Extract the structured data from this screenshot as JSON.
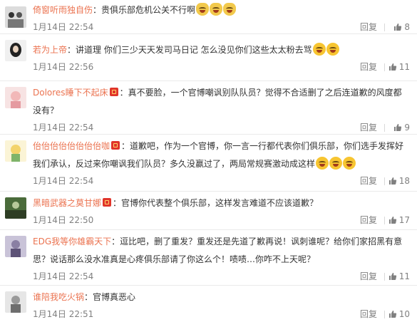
{
  "comments": [
    {
      "user": "倚窗听雨独自伤",
      "badge": false,
      "text": "：贵俱乐部危机公关不行啊",
      "emojis": [
        "cat-icon",
        "cat-icon",
        "cat-icon"
      ],
      "time": "1月14日 22:54",
      "reply": "回复",
      "likes": "8"
    },
    {
      "user": "若为上帝",
      "badge": false,
      "text": "：讲道理 你们三少天天发司马日记 怎么没见你们这些太太粉去骂",
      "emojis": [
        "laugh-icon",
        "laugh-icon"
      ],
      "time": "1月14日 22:56",
      "reply": "回复",
      "likes": "11"
    },
    {
      "user": "Dolores睡下不起床",
      "badge": true,
      "text": "：真不要脸，一个官博嘲讽别队队员？觉得不合适删了之后连道歉的风度都没有？",
      "emojis": [],
      "time": "1月14日 22:54",
      "reply": "回复",
      "likes": "9"
    },
    {
      "user": "佁佁佁佁佁佁佁佁咖",
      "badge": true,
      "text": "：道歉吧，作为一个官博，你一言一行都代表你们俱乐部，你们选手发挥好我们承认，反过来你嘲讽我们队员？多久没赢过了，两局常规赛激动成这样",
      "emojis": [
        "laugh-icon",
        "laugh-icon",
        "laugh-icon"
      ],
      "time": "1月14日 22:54",
      "reply": "回复",
      "likes": "18"
    },
    {
      "user": "黑暗武器之莫甘娜",
      "badge": true,
      "text": "：官博你代表整个俱乐部，这样发言难道不应该道歉？",
      "emojis": [],
      "time": "1月14日 22:50",
      "reply": "回复",
      "likes": "17"
    },
    {
      "user": "EDG我等你雄霸天下",
      "badge": false,
      "text": "：逗比吧，删了重发？重发还是先道了歉再说！讽刺谁呢？给你们家招黑有意思？说话那么没水准真是心疼俱乐部请了你这么个！啧啧…你咋不上天呢？",
      "emojis": [],
      "time": "1月14日 22:54",
      "reply": "回复",
      "likes": "11"
    },
    {
      "user": "谁陪我吃火锅",
      "badge": false,
      "text": "：官博真恶心",
      "emojis": [],
      "time": "1月14日 22:51",
      "reply": "回复",
      "likes": "10"
    }
  ]
}
